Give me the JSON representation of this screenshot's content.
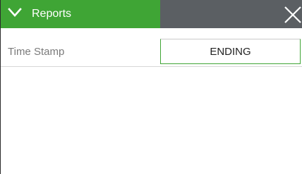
{
  "window": {
    "title": "Reports",
    "collapse_icon": "chevron-down-icon",
    "close_icon": "close-icon"
  },
  "fields": [
    {
      "label": "Time Stamp",
      "value": "ENDING"
    }
  ],
  "colors": {
    "accent": "#3fa535",
    "titlebar": "#5b5f63",
    "label_text": "#7a7a7a"
  }
}
